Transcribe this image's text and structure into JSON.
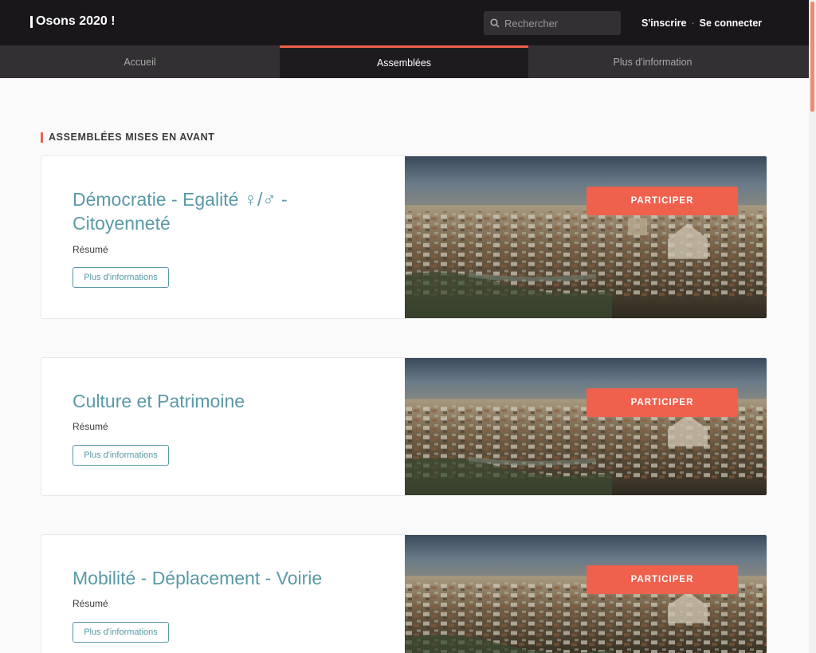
{
  "header": {
    "logo_text": "Osons 2020 !",
    "search_placeholder": "Rechercher",
    "signup_label": "S'inscrire",
    "separator": "·",
    "login_label": "Se connecter"
  },
  "nav": {
    "tabs": [
      {
        "label": "Accueil",
        "active": false
      },
      {
        "label": "Assemblées",
        "active": true
      },
      {
        "label": "Plus d'information",
        "active": false
      }
    ]
  },
  "section": {
    "title": "ASSEMBLÉES MISES EN AVANT"
  },
  "assemblies": [
    {
      "title": "Démocratie - Egalité ♀/♂ - Citoyenneté",
      "summary": "Résumé",
      "more_label": "Plus d'informations",
      "participate_label": "PARTICIPER"
    },
    {
      "title": "Culture et Patrimoine",
      "summary": "Résumé",
      "more_label": "Plus d'informations",
      "participate_label": "PARTICIPER"
    },
    {
      "title": "Mobilité - Déplacement - Voirie",
      "summary": "Résumé",
      "more_label": "Plus d'informations",
      "participate_label": "PARTICIPER"
    }
  ],
  "colors": {
    "accent": "#ef604d",
    "title_teal": "#599aa6",
    "header_bg": "#1a171b",
    "nav_bg": "#323032"
  }
}
